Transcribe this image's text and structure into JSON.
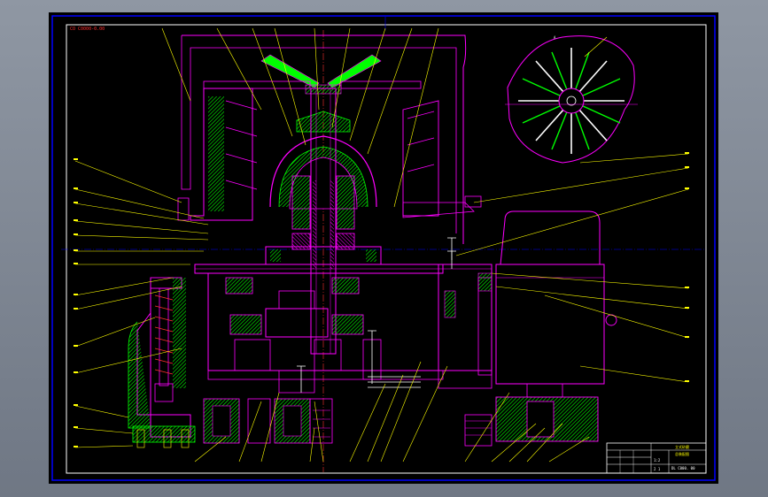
{
  "drawing": {
    "frame_code": "CO  C0000-0.00",
    "title_block": {
      "line1": "立式砂磨",
      "line2": "总装配图",
      "line3": "1:2",
      "line4": "DL C000. 00",
      "line5": "2   1"
    }
  },
  "colors": {
    "background": "#000000",
    "frame": "#0000ff",
    "part_outline": "#ff00ff",
    "section_fill": "#00ff00",
    "leader": "#ffff00",
    "centerline": "#ff3030",
    "bolt": "#ffffff"
  },
  "icons": [
    "blade-disc-detail",
    "electric-motor",
    "bearing-housing",
    "gear-pair"
  ]
}
